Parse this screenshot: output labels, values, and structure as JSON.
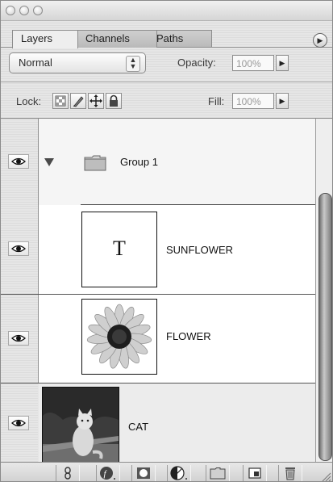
{
  "panel": {
    "tabs": [
      {
        "label": "Layers",
        "active": true
      },
      {
        "label": "Channels",
        "active": false
      },
      {
        "label": "Paths",
        "active": false
      }
    ]
  },
  "controls": {
    "blend_mode": "Normal",
    "opacity_label": "Opacity:",
    "opacity_value": "100%",
    "lock_label": "Lock:",
    "fill_label": "Fill:",
    "fill_value": "100%"
  },
  "layers": [
    {
      "name": "Group 1",
      "type": "group",
      "expanded": true,
      "visible": true
    },
    {
      "name": "SUNFLOWER",
      "type": "text",
      "thumb_glyph": "T",
      "visible": true
    },
    {
      "name": "FLOWER",
      "type": "image",
      "visible": true
    },
    {
      "name": "CAT",
      "type": "image",
      "visible": true
    }
  ],
  "icons": {
    "panel_menu": "panel-menu-icon",
    "blend_stepper": "stepper-arrows-icon",
    "lock_buttons": [
      "lock-transparent-icon",
      "lock-image-icon",
      "lock-position-icon",
      "lock-all-icon"
    ],
    "bottom_buttons": [
      "link-layers-icon",
      "layer-style-icon",
      "layer-mask-icon",
      "adjustment-layer-icon",
      "new-group-icon",
      "new-layer-icon",
      "trash-icon"
    ]
  }
}
